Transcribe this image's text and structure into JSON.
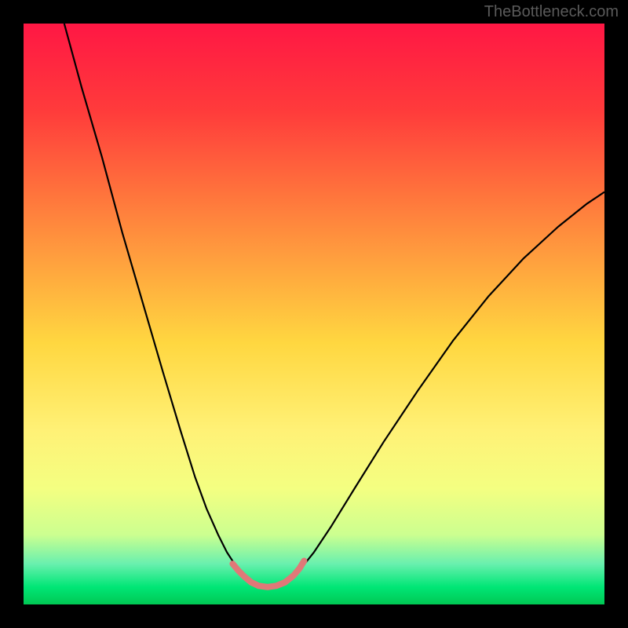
{
  "watermark": "TheBottleneck.com",
  "chart_data": {
    "type": "line",
    "title": "",
    "xlabel": "",
    "ylabel": "",
    "xlim": [
      0,
      100
    ],
    "ylim": [
      0,
      100
    ],
    "gradient_stops": [
      {
        "offset": 0,
        "color": "#ff1744"
      },
      {
        "offset": 15,
        "color": "#ff3b3b"
      },
      {
        "offset": 35,
        "color": "#ff8a3d"
      },
      {
        "offset": 55,
        "color": "#ffd740"
      },
      {
        "offset": 70,
        "color": "#fff176"
      },
      {
        "offset": 80,
        "color": "#f4ff81"
      },
      {
        "offset": 88,
        "color": "#ccff90"
      },
      {
        "offset": 93,
        "color": "#69f0ae"
      },
      {
        "offset": 97,
        "color": "#00e676"
      },
      {
        "offset": 100,
        "color": "#00c853"
      }
    ],
    "series": [
      {
        "name": "left-curve",
        "color": "#000000",
        "width": 2.2,
        "x": [
          7.0,
          10.0,
          13.5,
          17.0,
          20.5,
          24.0,
          27.0,
          29.5,
          31.5,
          33.5,
          35.0,
          36.3,
          37.2,
          38.0
        ],
        "y": [
          100.0,
          89.0,
          77.0,
          64.0,
          52.0,
          40.0,
          30.0,
          22.0,
          16.5,
          12.0,
          9.0,
          7.0,
          5.8,
          4.8
        ]
      },
      {
        "name": "right-curve",
        "color": "#000000",
        "width": 2.2,
        "x": [
          46.5,
          48.0,
          50.0,
          53.0,
          57.0,
          62.0,
          68.0,
          74.0,
          80.0,
          86.0,
          92.0,
          97.0,
          100.0
        ],
        "y": [
          5.0,
          6.5,
          9.0,
          13.5,
          20.0,
          28.0,
          37.0,
          45.5,
          53.0,
          59.5,
          65.0,
          69.0,
          71.0
        ]
      },
      {
        "name": "trough-highlight",
        "color": "#e07878",
        "width": 8,
        "linecap": "round",
        "x": [
          36.0,
          37.0,
          38.0,
          39.2,
          40.5,
          42.0,
          43.5,
          45.0,
          46.5,
          47.5,
          48.3
        ],
        "y": [
          7.0,
          5.8,
          4.8,
          3.8,
          3.2,
          3.0,
          3.2,
          3.8,
          5.0,
          6.2,
          7.5
        ]
      }
    ]
  }
}
